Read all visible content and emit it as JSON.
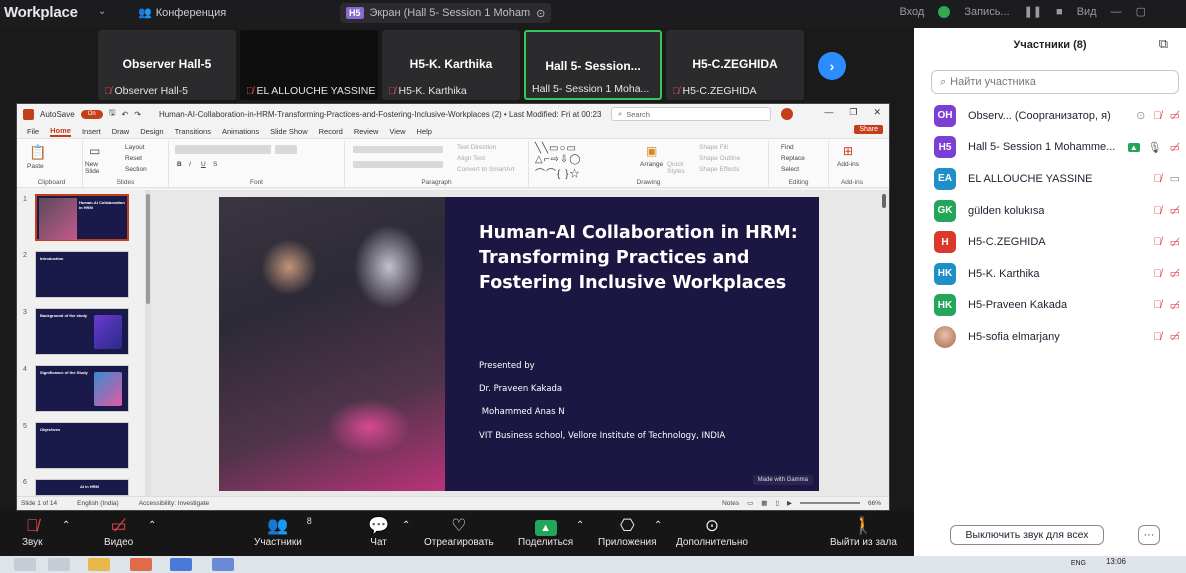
{
  "topbar": {
    "app_title": "Workplace",
    "conference_label": "Конференция",
    "screen_badge": "H5",
    "screen_label": "Экран (Hall 5- Session 1 Moham",
    "login_label": "Вход",
    "record_label": "Запись...",
    "view_label": "Вид"
  },
  "tiles": [
    {
      "big": "Observer  Hall-5",
      "small": "Observer  Hall-5"
    },
    {
      "big": "",
      "small": "EL ALLOUCHE YASSINE"
    },
    {
      "big": "H5-K. Karthika",
      "small": "H5-K. Karthika"
    },
    {
      "big": "Hall 5- Session...",
      "small": "Hall 5- Session 1 Moha..."
    },
    {
      "big": "H5-C.ZEGHIDA",
      "small": "H5-C.ZEGHIDA"
    }
  ],
  "ppt": {
    "autosave": "AutoSave",
    "toggle": "On",
    "filename": "Human-AI-Collaboration-in-HRM-Transforming-Practices-and-Fostering-Inclusive-Workplaces (2) • Last Modified: Fri at 00:23",
    "search_placeholder": "Search",
    "menu": [
      "File",
      "Home",
      "Insert",
      "Draw",
      "Design",
      "Transitions",
      "Animations",
      "Slide Show",
      "Record",
      "Review",
      "View",
      "Help"
    ],
    "share": "Share",
    "ribbon_groups": [
      "Clipboard",
      "Slides",
      "Font",
      "Paragraph",
      "Drawing",
      "Editing",
      "Add-ins"
    ],
    "ribbon_labels": {
      "paste": "Paste",
      "new_slide": "New Slide",
      "layout": "Layout",
      "reset": "Reset",
      "section": "Section",
      "arrange": "Arrange",
      "quick_styles": "Quick Styles",
      "shape_fill": "Shape Fill",
      "shape_outline": "Shape Outline",
      "shape_effects": "Shape Effects",
      "find": "Find",
      "replace": "Replace",
      "select": "Select",
      "add_ins": "Add-ins",
      "text_direction": "Text Direction",
      "align_text": "Align Text",
      "convert_smartart": "Convert to SmartArt"
    },
    "thumb_numbers": [
      "1",
      "2",
      "3",
      "4",
      "5",
      "6"
    ],
    "thumb_titles": [
      "Human-AI Collaboration in HRM",
      "Introduction",
      "Background of the study",
      "Significance of the Study",
      "Objectives",
      "AI in HRM"
    ],
    "slide": {
      "title": "Human-AI Collaboration in HRM: Transforming Practices and Fostering Inclusive Workplaces",
      "presented_by": "Presented by",
      "author1": "Dr. Praveen Kakada",
      "author2": " Mohammed Anas N",
      "affiliation": "VIT Business school, Vellore Institute of Technology, INDIA",
      "badge": "Made with Gamma"
    },
    "status": {
      "slide_of": "Slide 1 of 14",
      "language": "English (India)",
      "accessibility": "Accessibility: Investigate",
      "notes": "Notes",
      "zoom": "66%"
    }
  },
  "panel": {
    "title": "Участники (8)",
    "search_placeholder": "Найти участника",
    "participants": [
      {
        "initials": "OH",
        "name": "Observ...  (Соорганизатор, я)",
        "color": "#7b3fd6"
      },
      {
        "initials": "H5",
        "name": "Hall 5- Session 1 Mohamme...",
        "color": "#7b3fd6"
      },
      {
        "initials": "EA",
        "name": "EL ALLOUCHE YASSINE",
        "color": "#1f8fc7"
      },
      {
        "initials": "GK",
        "name": "gülden kolukısa",
        "color": "#23a55a"
      },
      {
        "initials": "H",
        "name": "H5-C.ZEGHIDA",
        "color": "#d93a2b"
      },
      {
        "initials": "HK",
        "name": "H5-K. Karthika",
        "color": "#1f8fc7"
      },
      {
        "initials": "HK",
        "name": "H5-Praveen Kakada",
        "color": "#23a55a"
      },
      {
        "initials": "",
        "name": "H5-sofia elmarjany",
        "color": "#c98a6a"
      }
    ],
    "mute_all": "Выключить звук для всех",
    "more": "···"
  },
  "controls": {
    "audio": "Звук",
    "video": "Видео",
    "participants": "Участники",
    "participants_count": "8",
    "chat": "Чат",
    "react": "Отреагировать",
    "share": "Поделиться",
    "apps": "Приложения",
    "more": "Дополнительно",
    "leave": "Выйти из зала"
  },
  "taskbar": {
    "lang": "ENG",
    "time": "13:06"
  }
}
